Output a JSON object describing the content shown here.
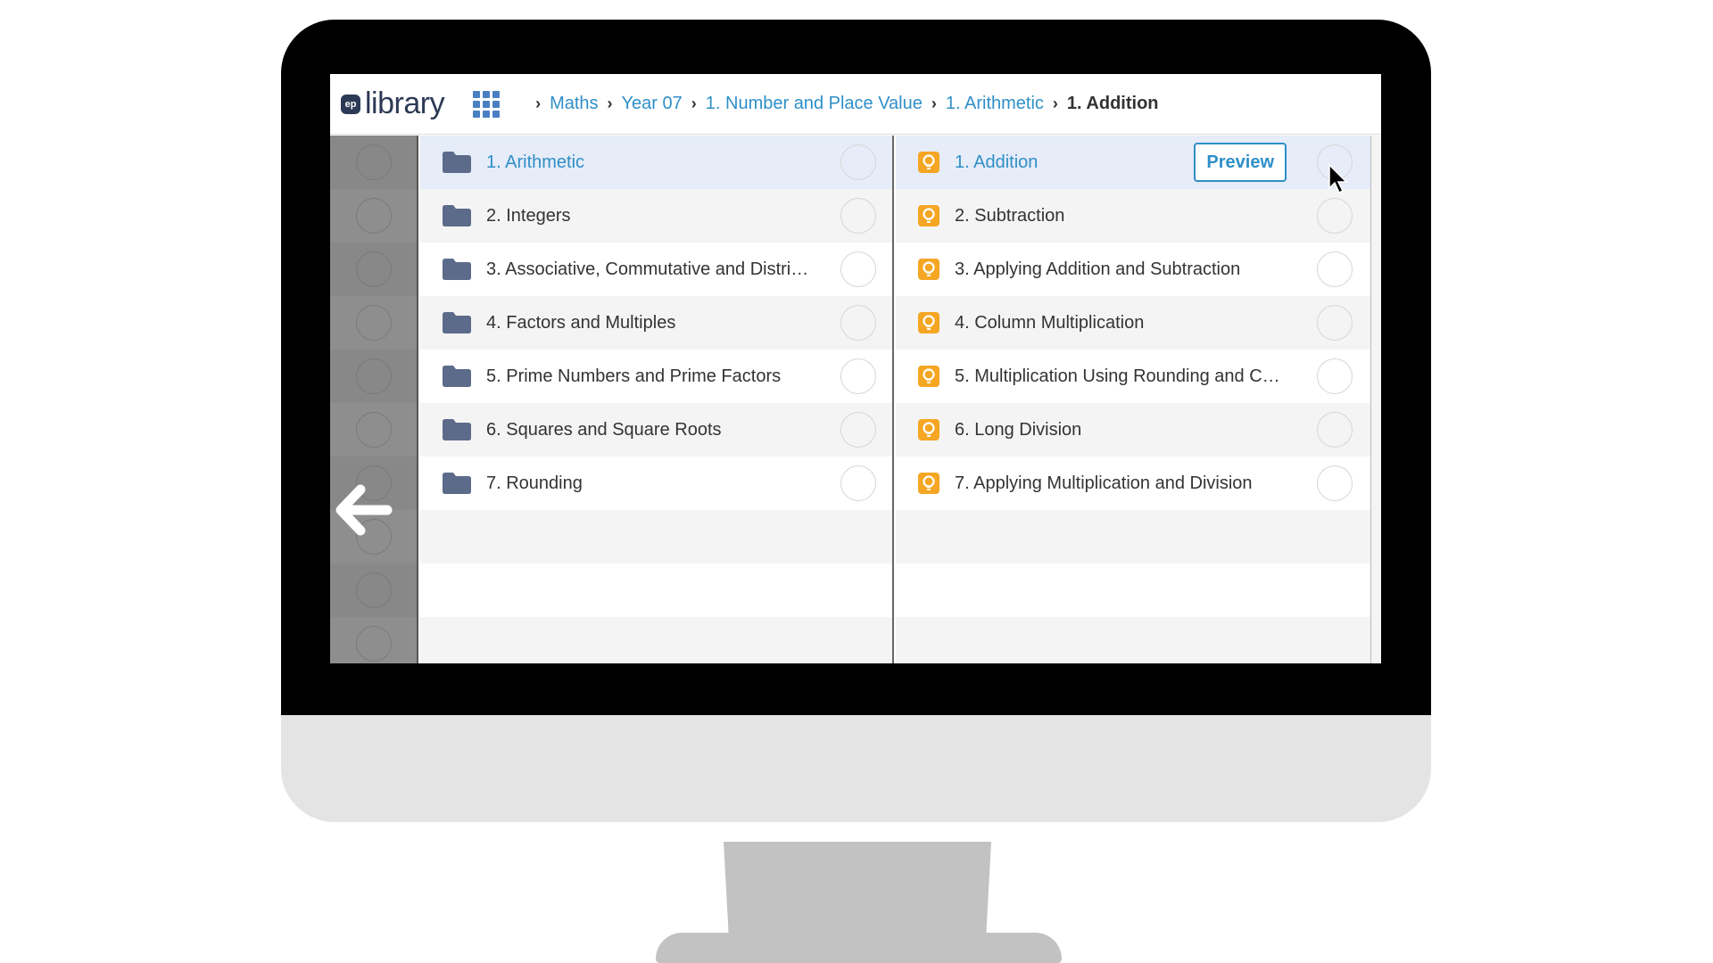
{
  "app": {
    "logo_badge": "ep",
    "logo_text": "library"
  },
  "breadcrumb": {
    "items": [
      "Maths",
      "Year 07",
      "1. Number and Place Value",
      "1. Arithmetic"
    ],
    "current": "1. Addition"
  },
  "folders": [
    {
      "label": "1. Arithmetic",
      "selected": true
    },
    {
      "label": "2. Integers"
    },
    {
      "label": "3. Associative, Commutative and Distri…"
    },
    {
      "label": "4. Factors and Multiples"
    },
    {
      "label": "5. Prime Numbers and Prime Factors"
    },
    {
      "label": "6. Squares and Square Roots"
    },
    {
      "label": "7. Rounding"
    }
  ],
  "lessons": [
    {
      "label": "1. Addition",
      "selected": true
    },
    {
      "label": "2. Subtraction"
    },
    {
      "label": "3. Applying Addition and Subtraction"
    },
    {
      "label": "4. Column Multiplication"
    },
    {
      "label": "5. Multiplication Using Rounding and C…"
    },
    {
      "label": "6. Long Division"
    },
    {
      "label": "7. Applying Multiplication and Division"
    }
  ],
  "preview_label": "Preview",
  "colors": {
    "accent": "#2f8fc7",
    "folder": "#5c6b8a",
    "lesson_icon": "#f5a623",
    "selected_row": "#e6ecf8"
  },
  "icons": {
    "folder": "folder-icon",
    "lesson": "lightbulb-icon",
    "back": "back-arrow-icon",
    "apps": "apps-grid-icon"
  }
}
